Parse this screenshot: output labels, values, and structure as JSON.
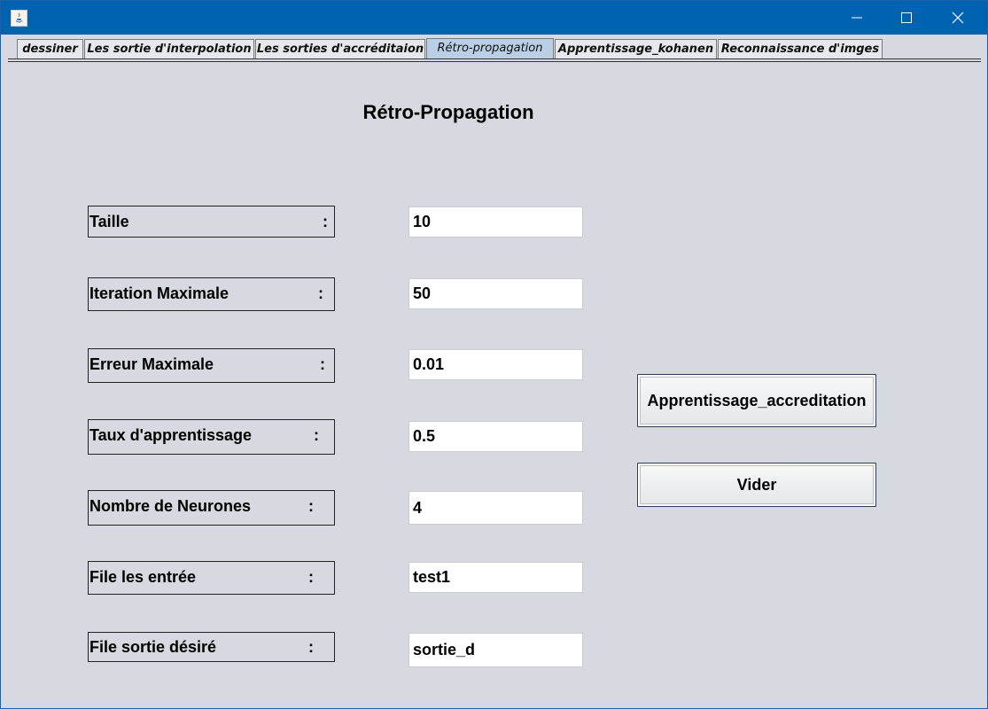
{
  "tabs": [
    {
      "label": "dessiner",
      "active": false
    },
    {
      "label": "Les sortie d'interpolation",
      "active": false
    },
    {
      "label": "Les sorties d'accréditaion",
      "active": false
    },
    {
      "label": "Rétro-propagation",
      "active": true
    },
    {
      "label": "Apprentissage_kohanen",
      "active": false
    },
    {
      "label": "Reconnaissance d'imges",
      "active": false
    }
  ],
  "page": {
    "title": "Rétro-Propagation"
  },
  "form": {
    "separator": ":",
    "rows": [
      {
        "label": "Taille",
        "value": "10"
      },
      {
        "label": "Iteration Maximale",
        "value": "50"
      },
      {
        "label": "Erreur Maximale",
        "value": "0.01"
      },
      {
        "label": "Taux d'apprentissage",
        "value": "0.5"
      },
      {
        "label": "Nombre de Neurones",
        "value": "4"
      },
      {
        "label": "File les entrée",
        "value": "test1"
      },
      {
        "label": "File sortie désiré",
        "value": "sortie_d"
      }
    ]
  },
  "buttons": {
    "train": "Apprentissage_accreditation",
    "clear": "Vider"
  },
  "colors": {
    "titlebar": "#0063b1",
    "background": "#d6d9e0",
    "active_tab": "#b8cfe5"
  }
}
